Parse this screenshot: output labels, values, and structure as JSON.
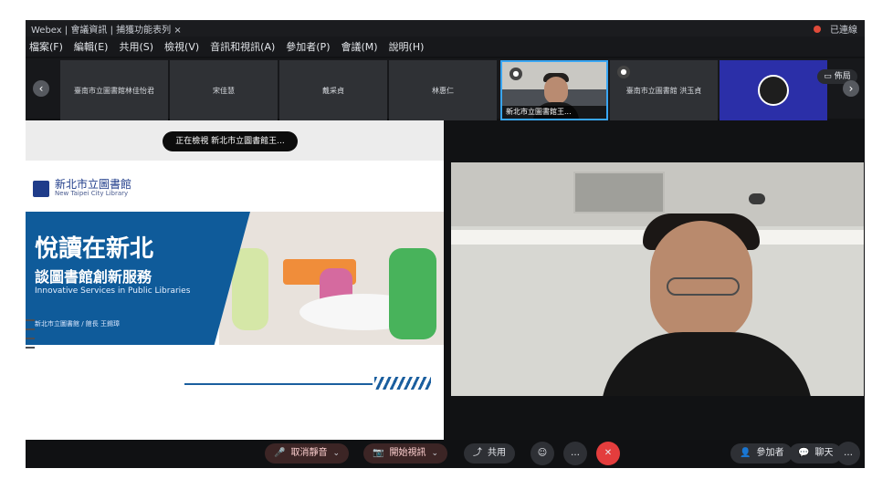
{
  "titlebar": {
    "left": "Webex  |  會議資訊  |  捕獲功能表列  ×",
    "right": "已連線"
  },
  "menu": [
    "檔案(F)",
    "編輯(E)",
    "共用(S)",
    "檢視(V)",
    "音訊和視訊(A)",
    "參加者(P)",
    "會議(M)",
    "說明(H)"
  ],
  "participants": [
    {
      "name": "臺南市立圖書館林佳怡君"
    },
    {
      "name": "宋佳慧"
    },
    {
      "name": "戴采貞"
    },
    {
      "name": "林惠仁"
    },
    {
      "name": "新北市立圖書館王..."
    },
    {
      "name": "臺南市立圖書館 洪玉貞"
    },
    {
      "name": ""
    }
  ],
  "layout_button": "佈局",
  "content_banner": "正在檢視 新北市立圖書館王...",
  "slide": {
    "logo_cn": "新北市立圖書館",
    "logo_en": "New Taipei City Library",
    "title": "悅讀在新北",
    "subtitle": "談圖書館創新服務",
    "english": "Innovative Services in Public Libraries",
    "author": "新北市立圖書館 / 館長 王錫璋"
  },
  "toolbar": {
    "mute": "取消靜音",
    "video": "開始視訊",
    "share": "共用",
    "participants": "參加者",
    "chat": "聊天"
  },
  "colors": {
    "accent": "#39a6f3",
    "danger": "#e33d3d",
    "slide_blue": "#0f5b9a"
  }
}
